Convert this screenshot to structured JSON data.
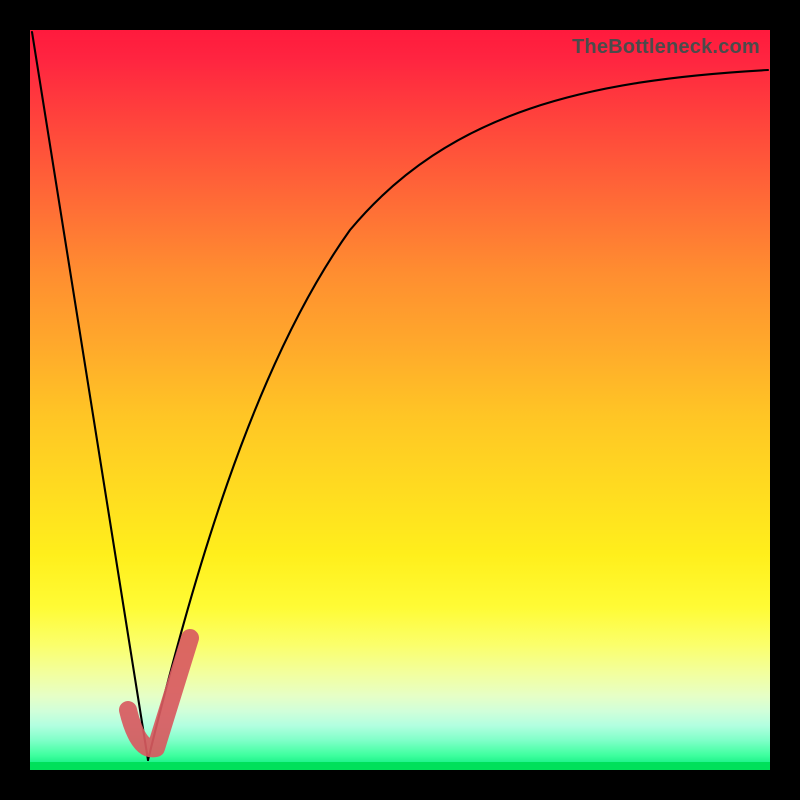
{
  "watermark": {
    "text": "TheBottleneck.com"
  },
  "colors": {
    "accent_tick": "#d85a5f",
    "curve": "#000000",
    "frame": "#000000"
  },
  "chart_data": {
    "type": "line",
    "title": "",
    "xlabel": "",
    "ylabel": "",
    "xlim": [
      0,
      100
    ],
    "ylim": [
      0,
      100
    ],
    "series": [
      {
        "name": "left-drop",
        "x": [
          0,
          3,
          6,
          9,
          12,
          14,
          15.5
        ],
        "values": [
          100,
          82,
          63,
          45,
          28,
          12,
          2
        ]
      },
      {
        "name": "right-rise",
        "x": [
          15.5,
          18,
          22,
          27,
          33,
          40,
          48,
          57,
          67,
          78,
          89,
          100
        ],
        "values": [
          2,
          15,
          33,
          49,
          62,
          72,
          79,
          84,
          88,
          91,
          93,
          94
        ]
      },
      {
        "name": "tick-mark",
        "x": [
          13,
          15.5,
          21
        ],
        "values": [
          10,
          2,
          20
        ]
      }
    ],
    "gradient_stops": [
      {
        "pos": 0,
        "hex": "#ff1a3d"
      },
      {
        "pos": 50,
        "hex": "#ffc525"
      },
      {
        "pos": 80,
        "hex": "#fbff6a"
      },
      {
        "pos": 100,
        "hex": "#00e676"
      }
    ]
  }
}
